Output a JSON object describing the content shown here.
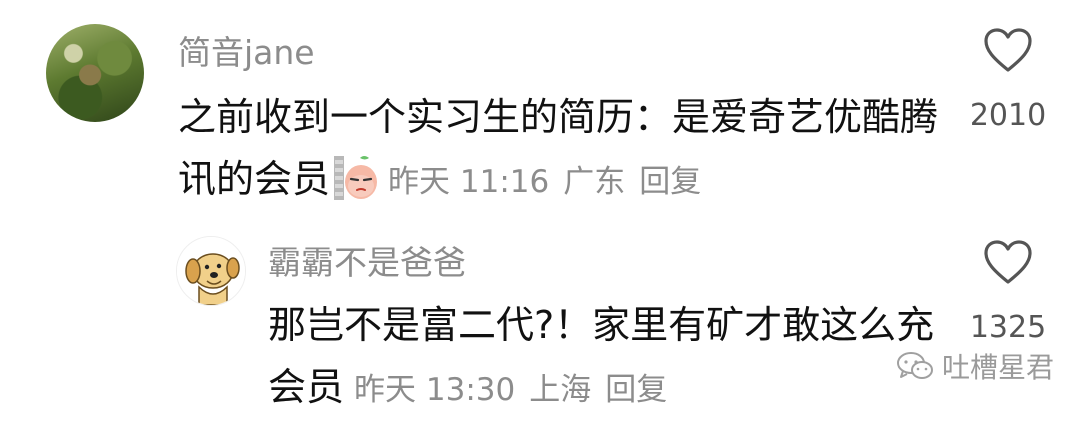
{
  "comments": [
    {
      "username": "简音jane",
      "text": "之前收到一个实习生的简历：是爱奇艺优酷腾讯的会员",
      "time": "昨天 11:16",
      "location": "广东",
      "reply_label": "回复",
      "likes": "2010",
      "avatar_icon": "photo-avatar",
      "sticker_icon": "sly-peach-emoji"
    },
    {
      "username": "霸霸不是爸爸",
      "text": "那岂不是富二代?！家里有矿才敢这么充会员",
      "time": "昨天 13:30",
      "location": "上海",
      "reply_label": "回复",
      "likes": "1325",
      "avatar_icon": "cartoon-dog-avatar"
    }
  ],
  "watermark": {
    "text": "吐槽星君",
    "icon": "wechat-icon"
  },
  "colors": {
    "primary_text": "#111111",
    "secondary_text": "#8c8c8c",
    "background": "#ffffff"
  }
}
